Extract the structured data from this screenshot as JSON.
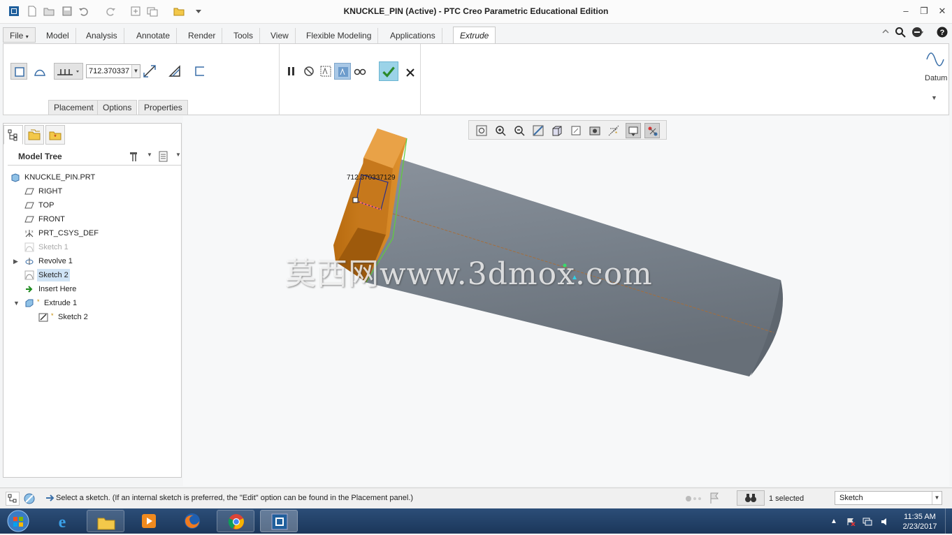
{
  "window": {
    "title": "KNUCKLE_PIN (Active) - PTC Creo Parametric Educational Edition"
  },
  "menu_tabs": [
    "File",
    "Model",
    "Analysis",
    "Annotate",
    "Render",
    "Tools",
    "View",
    "Flexible Modeling",
    "Applications",
    "Extrude"
  ],
  "ribbon": {
    "depth_value": "712.370337",
    "subtabs": [
      "Placement",
      "Options",
      "Properties"
    ],
    "datum_label": "Datum"
  },
  "left_panel": {
    "tree_title": "Model Tree",
    "items": [
      {
        "label": "KNUCKLE_PIN.PRT",
        "icon": "part-icon"
      },
      {
        "label": "RIGHT",
        "icon": "datum-plane-icon"
      },
      {
        "label": "TOP",
        "icon": "datum-plane-icon"
      },
      {
        "label": "FRONT",
        "icon": "datum-plane-icon"
      },
      {
        "label": "PRT_CSYS_DEF",
        "icon": "csys-icon"
      },
      {
        "label": "Sketch 1",
        "icon": "sketch-icon"
      },
      {
        "label": "Revolve 1",
        "icon": "revolve-icon"
      },
      {
        "label": "Sketch 2",
        "icon": "sketch-icon"
      },
      {
        "label": "Insert Here",
        "icon": "insert-arrow-icon"
      },
      {
        "label": "Extrude 1",
        "icon": "extrude-icon"
      },
      {
        "label": "Sketch 2",
        "icon": "sketch-icon"
      }
    ]
  },
  "viewport": {
    "dimension_label": "712.370337129",
    "watermark": "莫西网www.3dmox.com"
  },
  "status": {
    "message": "Select a sketch. (If an internal sketch is preferred, the \"Edit\" option can be found in the Placement panel.)",
    "selected": "1 selected",
    "filter": "Sketch"
  },
  "taskbar": {
    "time": "11:35 AM",
    "date": "2/23/2017"
  },
  "colors": {
    "hex_head": "#d2801c",
    "shaft": "#7c8590",
    "selection": "#cfe3f5",
    "accept": "#2b8a2b"
  }
}
